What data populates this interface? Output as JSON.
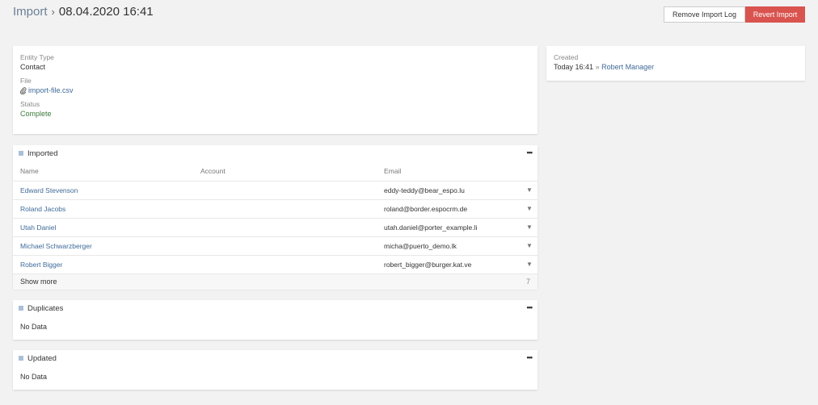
{
  "header": {
    "crumb": "Import",
    "separator": "›",
    "title": "08.04.2020 16:41"
  },
  "actions": {
    "remove_label": "Remove Import Log",
    "revert_label": "Revert Import"
  },
  "details": {
    "entity_type_label": "Entity Type",
    "entity_type_value": "Contact",
    "file_label": "File",
    "file_value": "import-file.csv",
    "status_label": "Status",
    "status_value": "Complete"
  },
  "side": {
    "created_label": "Created",
    "created_time": "Today 16:41",
    "created_sep": "»",
    "created_by": "Robert Manager"
  },
  "imported": {
    "title": "Imported",
    "columns": {
      "name": "Name",
      "account": "Account",
      "email": "Email"
    },
    "rows": [
      {
        "name": "Edward Stevenson",
        "account": "",
        "email": "eddy-teddy@bear_espo.lu"
      },
      {
        "name": "Roland Jacobs",
        "account": "",
        "email": "roland@border.espocrm.de"
      },
      {
        "name": "Utah Daniel",
        "account": "",
        "email": "utah.daniel@porter_example.li"
      },
      {
        "name": "Michael Schwarzberger",
        "account": "",
        "email": "micha@puerto_demo.lk"
      },
      {
        "name": "Robert Bigger",
        "account": "",
        "email": "robert_bigger@burger.kat.ve"
      }
    ],
    "show_more": "Show more",
    "remaining": "7"
  },
  "duplicates": {
    "title": "Duplicates",
    "empty": "No Data"
  },
  "updated": {
    "title": "Updated",
    "empty": "No Data"
  },
  "menu_glyph": "•••",
  "caret_glyph": "▼",
  "colors": {
    "danger": "#d9534f",
    "link": "#3f6a99",
    "accent_square": "#a9c0d8"
  }
}
